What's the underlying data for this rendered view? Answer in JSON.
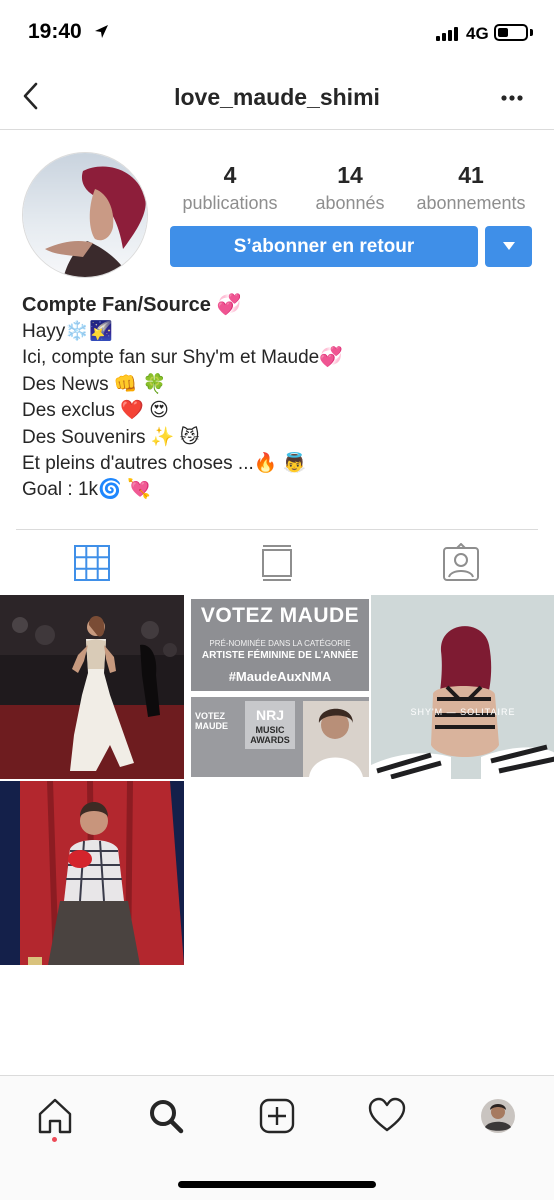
{
  "status_bar": {
    "time": "19:40",
    "network": "4G",
    "battery_level": 0.4
  },
  "header": {
    "username": "love_maude_shimi"
  },
  "stats": [
    {
      "count": "4",
      "label": "publications"
    },
    {
      "count": "14",
      "label": "abonnés"
    },
    {
      "count": "41",
      "label": "abonnements"
    }
  ],
  "actions": {
    "follow_label": "S’abonner en retour"
  },
  "bio": {
    "name": "Compte Fan/Source 💞",
    "lines": [
      "Hayy❄️🌠",
      "Ici, compte fan sur Shy'm et Maude💞",
      "Des News 👊 🍀",
      "Des exclus ❤️ 😍",
      "Des Souvenirs ✨ 😼",
      "Et pleins d'autres choses ...🔥 👼",
      "Goal : 1k🌀 💘"
    ]
  },
  "tabs": [
    "grid-icon",
    "feed-icon",
    "tagged-icon"
  ],
  "posts": {
    "votez": {
      "title": "VOTEZ MAUDE",
      "line1": "PRÉ-NOMINÉE DANS LA CATÉGORIE",
      "line2": "ARTISTE FÉMININE DE L'ANNÉE",
      "hashtag": "#MaudeAuxNMA",
      "mini_title": "VOTEZ MAUDE",
      "logo_top": "NRJ",
      "logo_line1": "MUSIC",
      "logo_line2": "AWARDS"
    },
    "album": {
      "caption": "SHY'M — SOLITAIRE"
    }
  },
  "nav": [
    "home-icon",
    "search-icon",
    "add-icon",
    "heart-icon",
    "profile-icon"
  ],
  "colors": {
    "accent": "#3f8fe8",
    "muted": "#8e8e8e",
    "border": "#dbdbdb"
  }
}
